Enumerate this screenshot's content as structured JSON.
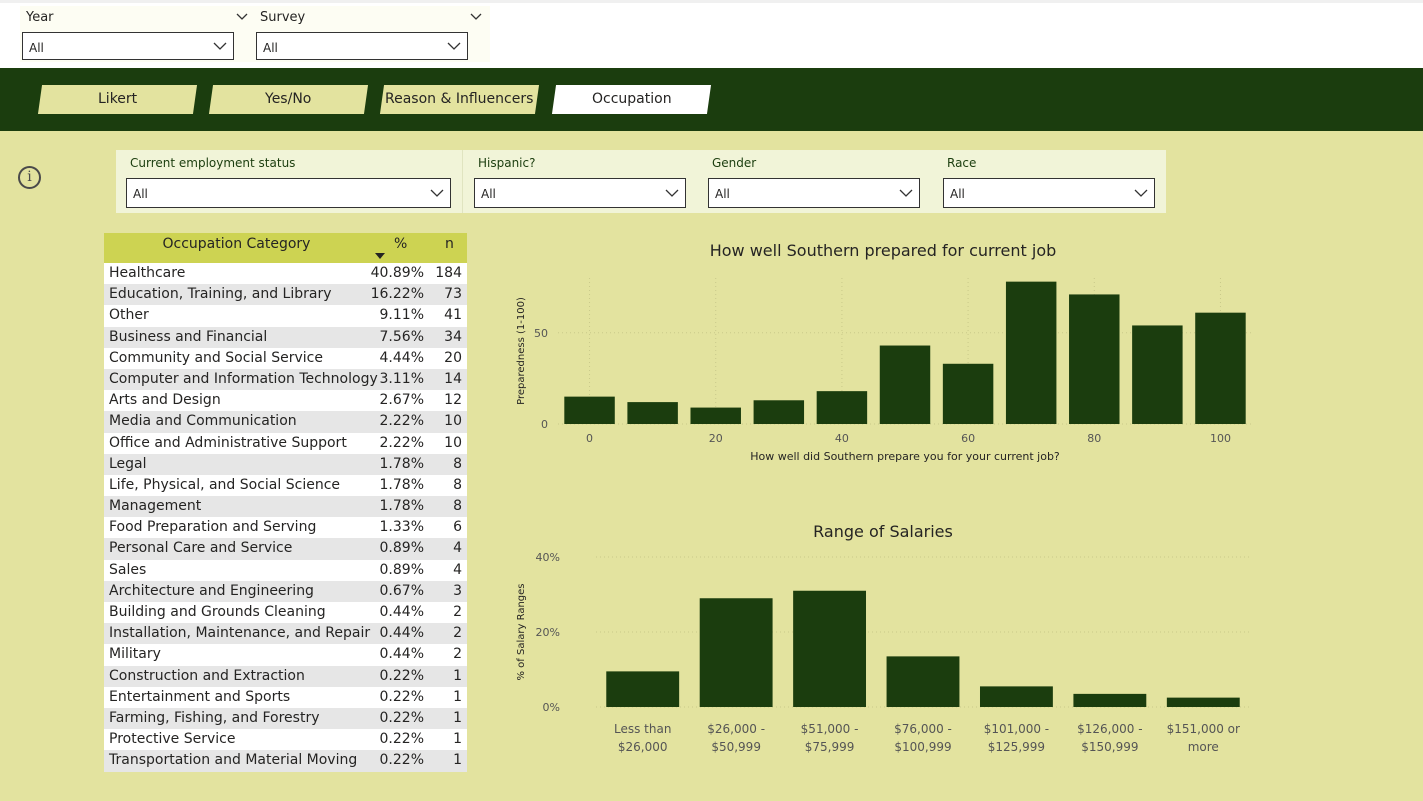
{
  "top_slicers": [
    {
      "title": "Year",
      "value": "All"
    },
    {
      "title": "Survey",
      "value": "All"
    }
  ],
  "tabs": [
    "Likert",
    "Yes/No",
    "Reason & Influencers",
    "Occupation"
  ],
  "active_tab": "Occupation",
  "filters": [
    {
      "label": "Current employment status",
      "value": "All"
    },
    {
      "label": "Hispanic?",
      "value": "All"
    },
    {
      "label": "Gender",
      "value": "All"
    },
    {
      "label": "Race",
      "value": "All"
    }
  ],
  "table": {
    "headers": {
      "category": "Occupation Category",
      "pct": "%",
      "n": "n"
    },
    "rows": [
      {
        "category": "Healthcare",
        "pct": "40.89%",
        "n": "184"
      },
      {
        "category": "Education, Training, and Library",
        "pct": "16.22%",
        "n": "73"
      },
      {
        "category": "Other",
        "pct": "9.11%",
        "n": "41"
      },
      {
        "category": "Business and Financial",
        "pct": "7.56%",
        "n": "34"
      },
      {
        "category": "Community and Social Service",
        "pct": "4.44%",
        "n": "20"
      },
      {
        "category": "Computer and Information Technology",
        "pct": "3.11%",
        "n": "14"
      },
      {
        "category": "Arts and Design",
        "pct": "2.67%",
        "n": "12"
      },
      {
        "category": "Media and Communication",
        "pct": "2.22%",
        "n": "10"
      },
      {
        "category": "Office and Administrative Support",
        "pct": "2.22%",
        "n": "10"
      },
      {
        "category": "Legal",
        "pct": "1.78%",
        "n": "8"
      },
      {
        "category": "Life, Physical, and Social Science",
        "pct": "1.78%",
        "n": "8"
      },
      {
        "category": "Management",
        "pct": "1.78%",
        "n": "8"
      },
      {
        "category": "Food Preparation and Serving",
        "pct": "1.33%",
        "n": "6"
      },
      {
        "category": "Personal Care and Service",
        "pct": "0.89%",
        "n": "4"
      },
      {
        "category": "Sales",
        "pct": "0.89%",
        "n": "4"
      },
      {
        "category": "Architecture and Engineering",
        "pct": "0.67%",
        "n": "3"
      },
      {
        "category": "Building and Grounds Cleaning",
        "pct": "0.44%",
        "n": "2"
      },
      {
        "category": "Installation, Maintenance, and Repair",
        "pct": "0.44%",
        "n": "2"
      },
      {
        "category": "Military",
        "pct": "0.44%",
        "n": "2"
      },
      {
        "category": "Construction and Extraction",
        "pct": "0.22%",
        "n": "1"
      },
      {
        "category": "Entertainment and Sports",
        "pct": "0.22%",
        "n": "1"
      },
      {
        "category": "Farming, Fishing, and Forestry",
        "pct": "0.22%",
        "n": "1"
      },
      {
        "category": "Protective Service",
        "pct": "0.22%",
        "n": "1"
      },
      {
        "category": "Transportation and Material Moving",
        "pct": "0.22%",
        "n": "1"
      }
    ]
  },
  "colors": {
    "bar": "#1b3d0e",
    "nav": "#1b3d0e",
    "background": "#e3e39f",
    "header": "#cdd352"
  },
  "chart_data": [
    {
      "type": "bar",
      "title": "How well Southern prepared for current job",
      "xlabel": "How well did Southern prepare you for your current job?",
      "ylabel": "Preparedness (1-100)",
      "x": [
        0,
        10,
        20,
        30,
        40,
        50,
        60,
        70,
        80,
        90,
        100
      ],
      "values": [
        15,
        12,
        9,
        13,
        18,
        43,
        33,
        78,
        71,
        54,
        61
      ],
      "xticks": [
        0,
        20,
        40,
        60,
        80,
        100
      ],
      "yticks": [
        0,
        50
      ],
      "ylim": [
        0,
        80
      ],
      "grid": true
    },
    {
      "type": "bar",
      "title": "Range of Salaries",
      "xlabel": "",
      "ylabel": "% of Salary Ranges",
      "categories": [
        [
          "Less than",
          "$26,000"
        ],
        [
          "$26,000 -",
          "$50,999"
        ],
        [
          "$51,000 -",
          "$75,999"
        ],
        [
          "$76,000 -",
          "$100,999"
        ],
        [
          "$101,000 -",
          "$125,999"
        ],
        [
          "$126,000 -",
          "$150,999"
        ],
        [
          "$151,000 or",
          "more"
        ]
      ],
      "values": [
        9.5,
        29,
        31,
        13.5,
        5.5,
        3.5,
        2.5
      ],
      "yticks": [
        "0%",
        "20%",
        "40%"
      ],
      "ytick_values": [
        0,
        20,
        40
      ],
      "ylim": [
        0,
        40
      ],
      "grid": true
    }
  ]
}
